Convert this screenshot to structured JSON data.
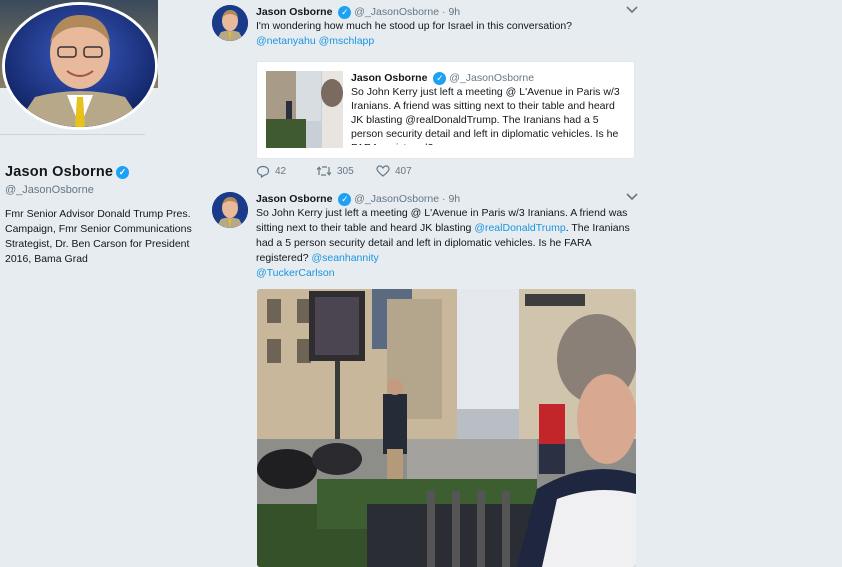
{
  "profile": {
    "name": "Jason Osborne",
    "handle": "@_JasonOsborne",
    "bio": "Fmr Senior Advisor Donald Trump Pres. Campaign, Fmr Senior Communications Strategist, Dr. Ben Carson for President 2016, Bama Grad",
    "verified": true
  },
  "tweets": [
    {
      "name": "Jason Osborne",
      "handle": "@_JasonOsborne",
      "dot": "·",
      "time": "9h",
      "text": "I'm wondering how much he stood up for Israel in this conversation?",
      "mentions": [
        "@netanyahu",
        "@mschlapp"
      ],
      "quote": {
        "name": "Jason Osborne",
        "handle": "@_JasonOsborne",
        "text": "So John Kerry just left a meeting @ L'Avenue in Paris w/3 Iranians. A friend was sitting next to their table and heard JK blasting @realDonaldTrump. The Iranians had a 5 person security detail and left in diplomatic vehicles. Is he FARA registered?"
      },
      "actions": {
        "replies": "42",
        "retweets": "305",
        "likes": "407"
      }
    },
    {
      "name": "Jason Osborne",
      "handle": "@_JasonOsborne",
      "dot": "·",
      "time": "9h",
      "text_a": "So John Kerry just left a meeting @ L'Avenue in Paris w/3 Iranians. A friend was sitting next to their table and heard JK blasting ",
      "mention_a": "@realDonaldTrump",
      "text_b": ". The Iranians had a 5 person security detail and left in diplomatic vehicles. Is he FARA registered? ",
      "mention_b": "@seanhannity",
      "mention_c": "@TuckerCarlson"
    }
  ],
  "icons": {
    "verified": "verified-badge-icon",
    "caret": "chevron-down-icon",
    "reply": "reply-icon",
    "retweet": "retweet-icon",
    "like": "heart-icon"
  },
  "colors": {
    "link": "#1b95e0",
    "verified": "#1da1f2",
    "background": "#e6ecf0"
  }
}
